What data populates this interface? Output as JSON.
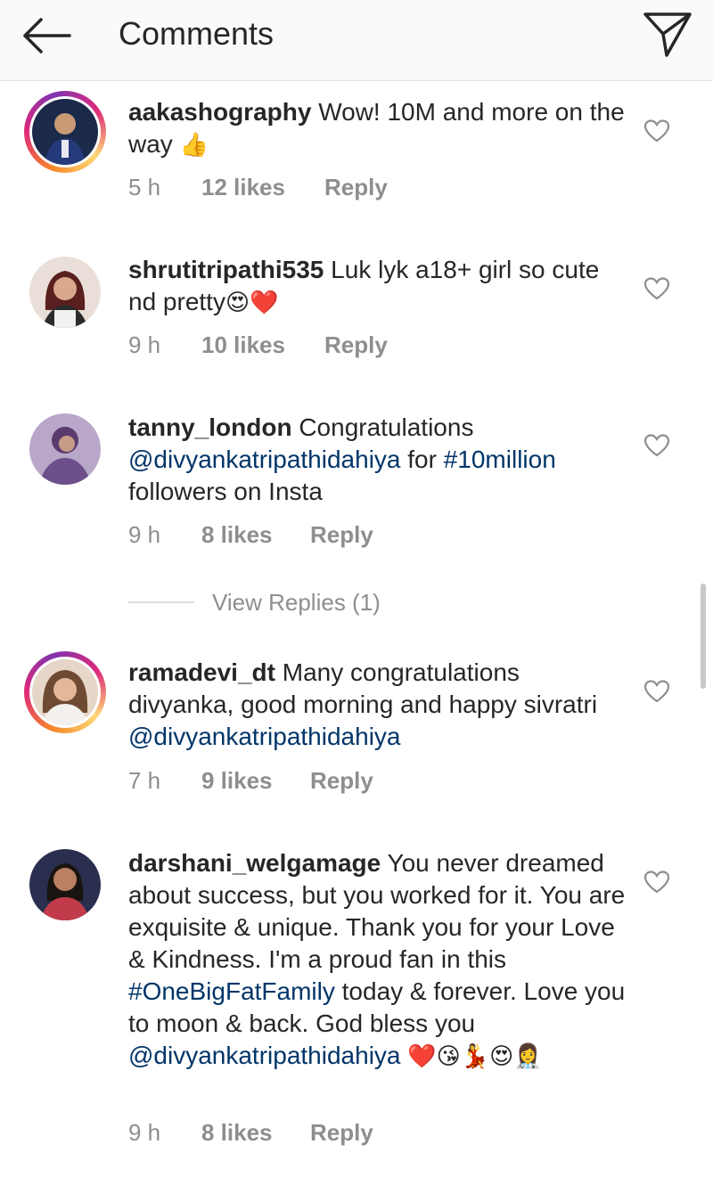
{
  "header": {
    "title": "Comments",
    "back_icon": "arrow-left-icon",
    "send_icon": "paper-plane-icon"
  },
  "comments": [
    {
      "username": "aakashography",
      "segments": [
        {
          "type": "text",
          "value": " Wow! 10M and more on the way "
        },
        {
          "type": "emoji",
          "value": "👍"
        }
      ],
      "time": "5 h",
      "likes": "12 likes",
      "reply": "Reply",
      "has_story_ring": true
    },
    {
      "username": "shrutitripathi535",
      "segments": [
        {
          "type": "text",
          "value": " Luk lyk a18+ girl so cute nd pretty"
        },
        {
          "type": "emoji",
          "value": "😍❤️"
        }
      ],
      "time": "9 h",
      "likes": "10 likes",
      "reply": "Reply",
      "has_story_ring": false
    },
    {
      "username": "tanny_london",
      "segments": [
        {
          "type": "text",
          "value": " Congratulations "
        },
        {
          "type": "mention",
          "value": "@divyankatripathidahiya"
        },
        {
          "type": "text",
          "value": " for "
        },
        {
          "type": "hashtag",
          "value": "#10million"
        },
        {
          "type": "text",
          "value": " followers on Insta"
        }
      ],
      "time": "9 h",
      "likes": "8 likes",
      "reply": "Reply",
      "has_story_ring": false,
      "view_replies": "View Replies (1)"
    },
    {
      "username": "ramadevi_dt",
      "segments": [
        {
          "type": "text",
          "value": " Many congratulations divyanka, good morning and happy sivratri "
        },
        {
          "type": "mention",
          "value": "@divyankatripathidahiya"
        }
      ],
      "time": "7 h",
      "likes": "9 likes",
      "reply": "Reply",
      "has_story_ring": true
    },
    {
      "username": "darshani_welgamage",
      "segments": [
        {
          "type": "text",
          "value": " You never dreamed about success, but you worked for it. You are exquisite & unique. Thank you for your Love & Kindness. I'm a proud fan in this "
        },
        {
          "type": "hashtag",
          "value": "#OneBigFatFamily"
        },
        {
          "type": "text",
          "value": " today & forever. Love you to moon & back. God bless you "
        },
        {
          "type": "mention",
          "value": "@divyankatripathidahiya"
        },
        {
          "type": "text",
          "value": " "
        },
        {
          "type": "emoji",
          "value": "❤️😘💃😍👩‍⚕️"
        }
      ],
      "time": "9 h",
      "likes": "8 likes",
      "reply": "Reply",
      "has_story_ring": false
    }
  ],
  "icons": {
    "like": "heart-outline-icon"
  },
  "colors": {
    "link": "#003569",
    "muted": "#8e8e8e",
    "text": "#262626"
  }
}
